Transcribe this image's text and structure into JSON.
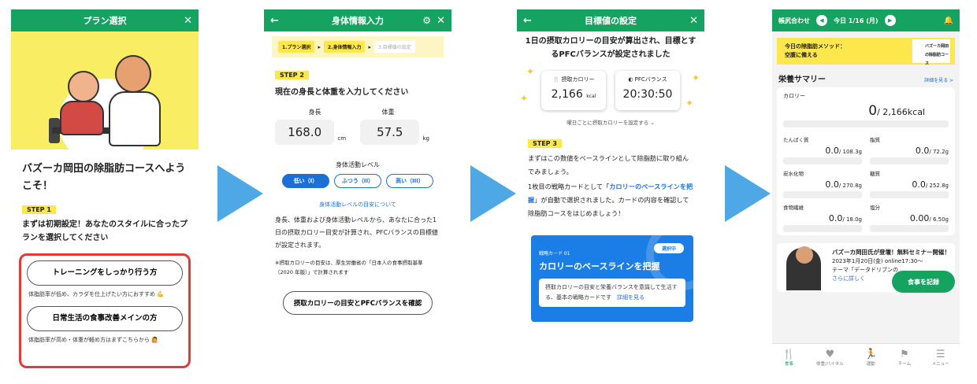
{
  "screen1": {
    "header_title": "プラン選択",
    "close_glyph": "✕",
    "title": "バズーカ岡田の除脂肪コースへようこそ！",
    "step": "STEP 1",
    "lead": "まずは初期設定！あなたのスタイルに合ったプランを選択してください",
    "option1": "トレーニングをしっかり行う方",
    "option1_note": "体脂肪率が低め、カラダを仕上げたい方におすすめ 💪",
    "option2": "日常生活の食事改善メインの方",
    "option2_note": "体脂肪率が高め・体重が軽め方はまずこちらから 🙋"
  },
  "screen2": {
    "header_title": "身体情報入力",
    "back_glyph": "←",
    "gear_glyph": "⚙",
    "close_glyph": "✕",
    "crumbs": [
      "1.プラン選択",
      "2.身体情報入力",
      "3.目標値の設定"
    ],
    "step": "STEP 2",
    "heading": "現在の身長と体重を入力してください",
    "height_label": "身長",
    "weight_label": "体重",
    "height_value": "168.0",
    "height_unit": "cm",
    "weight_value": "57.5",
    "weight_unit": "kg",
    "activity_label": "身体活動レベル",
    "levels": [
      "低い（I）",
      "ふつう（II）",
      "高い（III）"
    ],
    "activity_link": "身体活動レベルの目安について",
    "para": "身長、体重および身体活動レベルから、あなたに合った1日の摂取カロリー目安が計算され、PFCバランスの目標値が設定されます。",
    "small": "※摂取カロリーの目安は、厚生労働省の「日本人の食事摂取基準（2020 年版）」で計算されます",
    "confirm_button": "摂取カロリーの目安とPFCバランスを確認"
  },
  "screen3": {
    "header_title": "目標値の設定",
    "back_glyph": "←",
    "close_glyph": "✕",
    "headline": "1日の摂取カロリーの目安が算出され、目標とするPFCバランスが設定されました",
    "kcal_label": "🍴 摂取カロリー",
    "kcal_value": "2,166",
    "kcal_unit": "kcal",
    "pfc_label": "◐ PFCバランス",
    "pfc_value": "20:30:50",
    "set_by_day": "曜日ごとに摂取カロリーを設定する ⌄",
    "step": "STEP 3",
    "para1": "まずはこの数値をベースラインとして除脂肪に取り組んでみましょう。",
    "para2_pre": "1枚目の戦略カードとして「",
    "para2_hl": "カロリーのベースラインを把握",
    "para2_post": "」が自動で選択されました。カードの内容を確認して除脂肪コースをはじめましょう！",
    "card_label": "戦略カード 01",
    "card_selected": "選択中",
    "card_title": "カロリーのベースラインを把握",
    "card_desc": "摂取カロリーの目安と栄養バランスを意識して生活する、基本の戦略カードです",
    "card_more": "詳細を見る"
  },
  "screen4": {
    "user": "帳尻合わせ",
    "date": "今日 1/16 (月)",
    "banner_title": "今日の除脂肪メソッド：",
    "banner_sub": "空腹に備える",
    "banner_mini": "バズーカ岡田の除脂肪コース",
    "summary_title": "栄養サマリー",
    "summary_more": "詳細を見る >",
    "calorie_label": "カロリー",
    "calorie_value": "0",
    "calorie_target": "/ 2,166kcal",
    "nutrients": [
      {
        "label": "たんぱく質",
        "value": "0.0",
        "target": "/ 108.3g"
      },
      {
        "label": "脂質",
        "value": "0.0",
        "target": "/ 72.2g"
      },
      {
        "label": "炭水化物",
        "value": "0.0",
        "target": "/ 270.8g"
      },
      {
        "label": "糖質",
        "value": "0.0",
        "target": "/ 252.8g"
      },
      {
        "label": "食物繊維",
        "value": "0.0",
        "target": "/ 18.0g"
      },
      {
        "label": "塩分",
        "value": "0.00",
        "target": "/ 6.50g"
      }
    ],
    "promo_title": "バズーカ岡田氏が登壇！無料セミナー開催！",
    "promo_line1": "2023年1月20日(金) online17:30～",
    "promo_line2": "テーマ「データドリブンの",
    "promo_more": "さらに詳しく",
    "fab": "食事を記録",
    "tabs": [
      "食事",
      "体重/バイタル",
      "運動",
      "チーム",
      "メニュー"
    ]
  }
}
